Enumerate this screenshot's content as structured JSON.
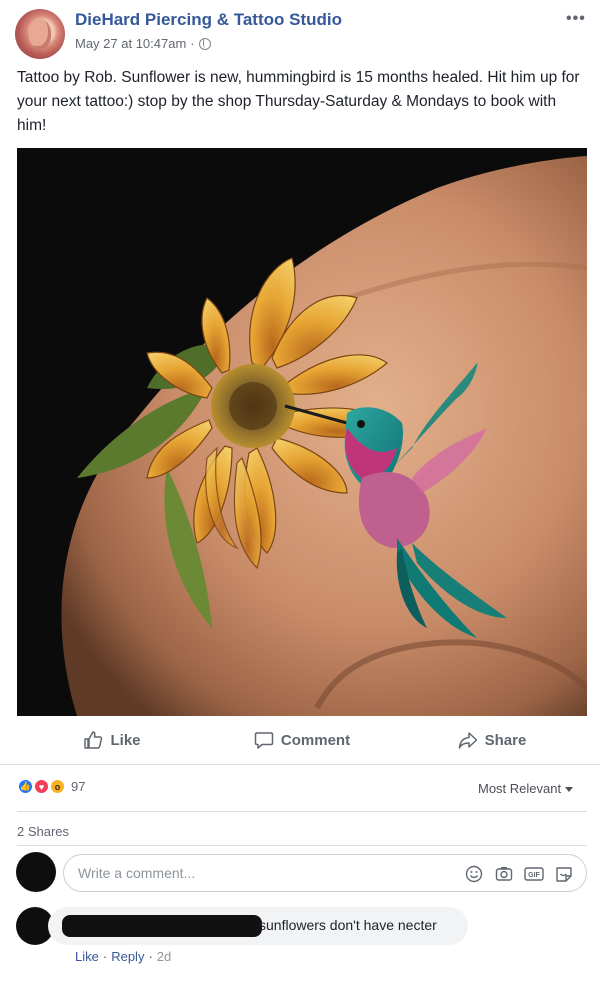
{
  "post": {
    "page_name": "DieHard Piercing & Tattoo Studio",
    "date": "May 27 at 10:47am",
    "separator": "·",
    "text": "Tattoo by Rob. Sunflower is new, hummingbird is 15 months healed. Hit him up for your next tattoo:) stop by the shop Thursday-Saturday & Mondays to book with him!"
  },
  "actions": {
    "like": "Like",
    "comment": "Comment",
    "share": "Share"
  },
  "reactions": {
    "count": "97",
    "types": [
      "like",
      "love",
      "wow"
    ],
    "sort_label": "Most Relevant"
  },
  "shares": "2 Shares",
  "comment_box": {
    "placeholder": "Write a comment...",
    "icons": [
      "emoji-icon",
      "camera-icon",
      "gif-icon",
      "sticker-icon"
    ]
  },
  "comment": {
    "text": "sunflowers don't have necter",
    "like": "Like",
    "reply": "Reply",
    "time": "2d",
    "dot": "·"
  },
  "colors": {
    "link": "#365899",
    "like_blue": "#2078f4",
    "love_red": "#f33e58",
    "wow_yellow": "#f7b125",
    "divider": "#dadde1"
  }
}
